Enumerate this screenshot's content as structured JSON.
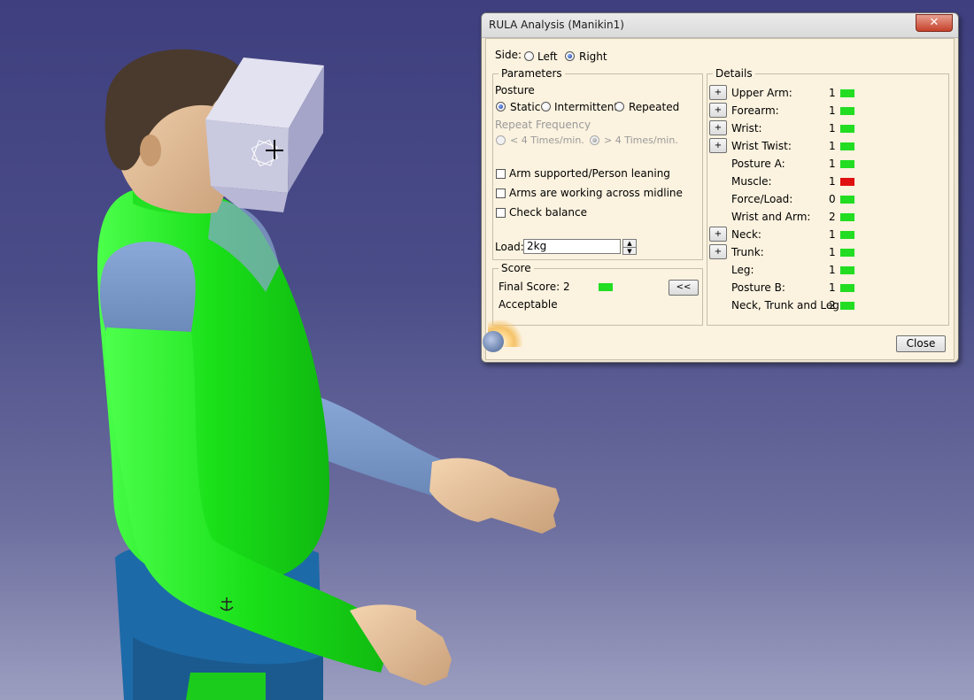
{
  "window": {
    "title": "RULA Analysis (Manikin1)",
    "close_glyph": "✕"
  },
  "side": {
    "label": "Side:",
    "options": [
      "Left",
      "Right"
    ],
    "selected": "Right"
  },
  "parameters": {
    "group_label": "Parameters",
    "posture_label": "Posture",
    "posture_options": [
      "Static",
      "Intermittent",
      "Repeated"
    ],
    "posture_selected": "Static",
    "repeat_label": "Repeat Frequency",
    "repeat_options": [
      "< 4 Times/min.",
      "> 4 Times/min."
    ],
    "repeat_selected": "> 4 Times/min.",
    "checkboxes": [
      "Arm supported/Person leaning",
      "Arms are working across midline",
      "Check balance"
    ],
    "load_label": "Load:",
    "load_value": "2kg"
  },
  "score": {
    "group_label": "Score",
    "final_score_text": "Final Score: 2",
    "verdict": "Acceptable",
    "collapse_button": "<<"
  },
  "details": {
    "group_label": "Details",
    "rows": [
      {
        "label": "Upper Arm:",
        "value": "1",
        "color": "#22dd22",
        "expand": "+"
      },
      {
        "label": "Forearm:",
        "value": "1",
        "color": "#22dd22",
        "expand": "+"
      },
      {
        "label": "Wrist:",
        "value": "1",
        "color": "#22dd22",
        "expand": "+"
      },
      {
        "label": "Wrist Twist:",
        "value": "1",
        "color": "#22dd22",
        "expand": "+"
      },
      {
        "label": "Posture A:",
        "value": "1",
        "color": "#22dd22"
      },
      {
        "label": "Muscle:",
        "value": "1",
        "color": "#e01010"
      },
      {
        "label": "Force/Load:",
        "value": "0",
        "color": "#22dd22"
      },
      {
        "label": "Wrist and Arm:",
        "value": "2",
        "color": "#22dd22"
      },
      {
        "label": "Neck:",
        "value": "1",
        "color": "#22dd22",
        "expand": "+"
      },
      {
        "label": "Trunk:",
        "value": "1",
        "color": "#22dd22",
        "expand": "+"
      },
      {
        "label": "Leg:",
        "value": "1",
        "color": "#22dd22"
      },
      {
        "label": "Posture B:",
        "value": "1",
        "color": "#22dd22"
      },
      {
        "label": "Neck, Trunk and Leg:",
        "value": "2",
        "color": "#22dd22"
      }
    ]
  },
  "close_button": "Close",
  "colors": {
    "score_ok": "#22dd22",
    "score_bad": "#e01010",
    "body_green": "#22e022"
  }
}
